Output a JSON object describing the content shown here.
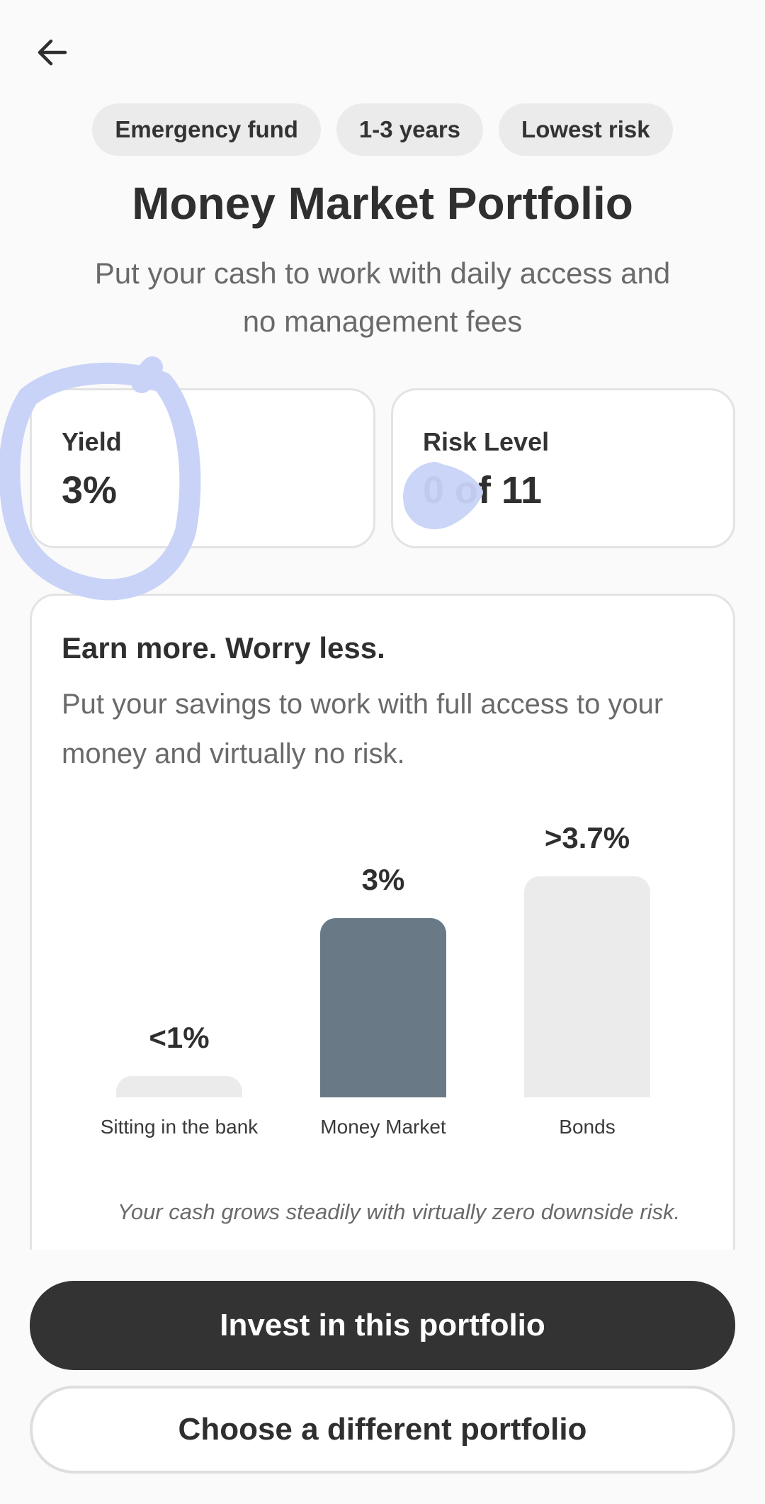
{
  "header": {
    "back_icon": "arrow-left-icon"
  },
  "tags": [
    "Emergency fund",
    "1-3 years",
    "Lowest risk"
  ],
  "title": "Money Market Portfolio",
  "subtitle": "Put your cash to work with daily access and no management fees",
  "stats": {
    "yield": {
      "label": "Yield",
      "value": "3%"
    },
    "risk": {
      "label": "Risk Level",
      "value": "0 of 11"
    }
  },
  "info": {
    "heading": "Earn more. Worry less.",
    "body": "Put your savings to work with full access to your money and virtually no risk.",
    "footnote": "Your cash grows steadily with virtually zero downside risk."
  },
  "chart_data": {
    "type": "bar",
    "categories": [
      "Sitting in the bank",
      "Money Market",
      "Bonds"
    ],
    "values": [
      1,
      3,
      3.7
    ],
    "value_labels": [
      "<1%",
      "3%",
      ">3.7%"
    ],
    "bar_colors": [
      "#ebebeb",
      "#697986",
      "#ebebeb"
    ],
    "ylim": [
      0,
      3.7
    ],
    "grid": false
  },
  "buttons": {
    "primary": "Invest in this portfolio",
    "secondary": "Choose a different portfolio"
  },
  "colors": {
    "highlight": "#c9d3f7",
    "accent_bar": "#697986",
    "button_dark": "#333333"
  }
}
